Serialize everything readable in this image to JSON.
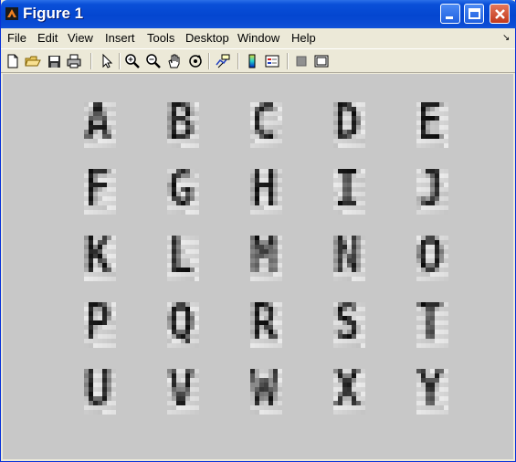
{
  "window": {
    "title": "Figure 1"
  },
  "menu": {
    "items": [
      "File",
      "Edit",
      "View",
      "Insert",
      "Tools",
      "Desktop",
      "Window",
      "Help"
    ],
    "overflow_symbol": "↘"
  },
  "toolbar": {
    "tools": [
      "new-file-icon",
      "open-folder-icon",
      "save-icon",
      "print-icon",
      "pointer-arrow-icon",
      "zoom-in-icon",
      "zoom-out-icon",
      "pan-hand-icon",
      "rotate-3d-icon",
      "data-cursor-icon",
      "colorbar-icon",
      "legend-icon",
      "hide-plot-tools-icon",
      "show-plot-tools-icon"
    ]
  },
  "figure": {
    "description_grid_rows": 5,
    "glyphs": [
      "A",
      "B",
      "C",
      "D",
      "E",
      "F",
      "G",
      "H",
      "I",
      "J",
      "K",
      "L",
      "M",
      "N",
      "O",
      "P",
      "Q",
      "R",
      "S",
      "T",
      "U",
      "V",
      "W",
      "X",
      "Y"
    ]
  },
  "colors": {
    "canvas": "#c8c8c8",
    "chrome": "#ece9d8",
    "titlebar": "#0a4bd4"
  }
}
